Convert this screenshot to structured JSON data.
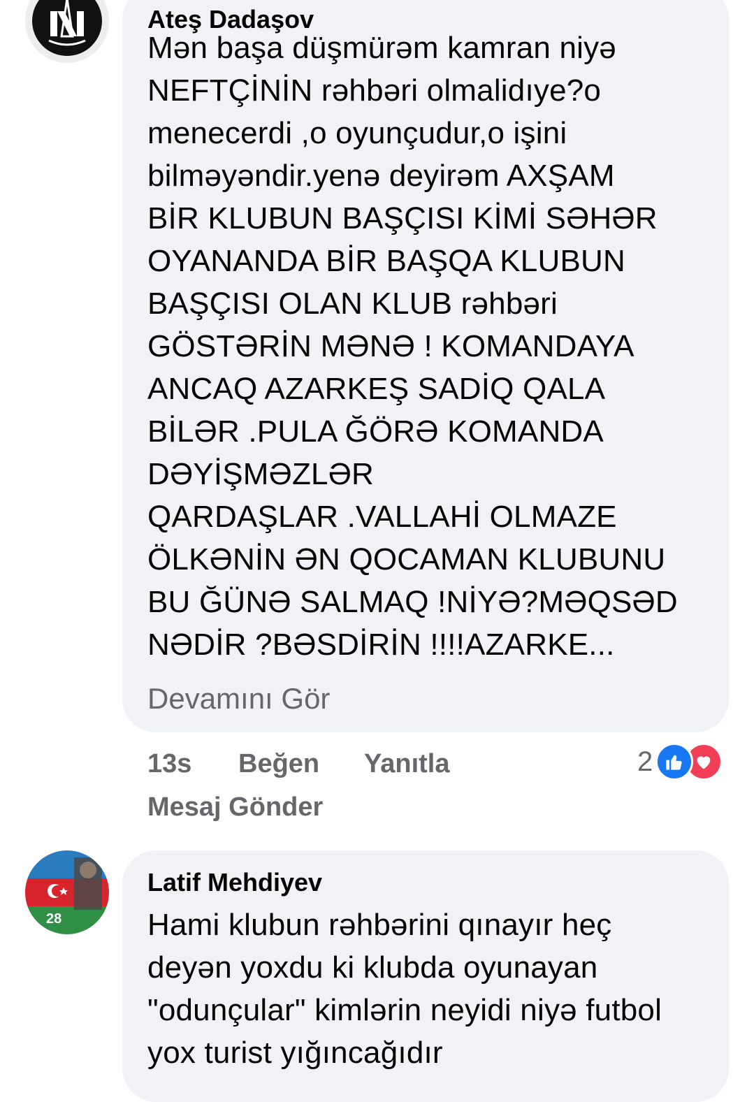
{
  "comments": [
    {
      "author": "Ateş Dadaşov",
      "text": "Mən başa düşmürəm kamran niyə\nNEFTÇİNİN rəhbəri olmalidıye?o\nmenecerdi ,o oyunçudur,o işini\nbilməyəndir.yenə deyirəm AXŞAM\nBİR KLUBUN BAŞÇISI KİMİ SƏHƏR\nOYANANDA BİR BAŞQA KLUBUN\nBAŞÇISI OLAN KLUB rəhbəri\nGÖSTƏRİN MƏNƏ ! KOMANDAYA\nANCAQ AZARKEŞ SADİQ QALA\nBİLƏR .PULA ĞÖRƏ KOMANDA\nDƏYİŞMƏZLƏR\nQARDAŞLAR .VALLAHİ OLMAZE\nÖLKƏNİN ƏN QOCAMAN KLUBUNU\nBU ĞÜNƏ SALMAQ !NİYƏ?MƏQSƏD\nNƏDİR ?BƏSDİRİN !!!!AZARKE...",
      "see_more": "Devamını Gör",
      "time": "13s",
      "like_label": "Beğen",
      "reply_label": "Yanıtla",
      "message_label": "Mesaj Gönder",
      "reaction_count": "2",
      "reaction_icons": [
        "like-icon",
        "love-icon"
      ]
    },
    {
      "author": "Latif Mehdiyev",
      "text": "Hami klubun rəhbərini qınayır heç\ndeyən yoxdu ki klubda oyunayan\n\"odunçular\" kimlərin neyidi niyə futbol\nyox turist yığıncağıdır"
    }
  ],
  "colors": {
    "bubble": "#f0f2f5",
    "secondary_text": "#65676b",
    "like_blue": "#1877f2",
    "love_red": "#f33e58"
  }
}
